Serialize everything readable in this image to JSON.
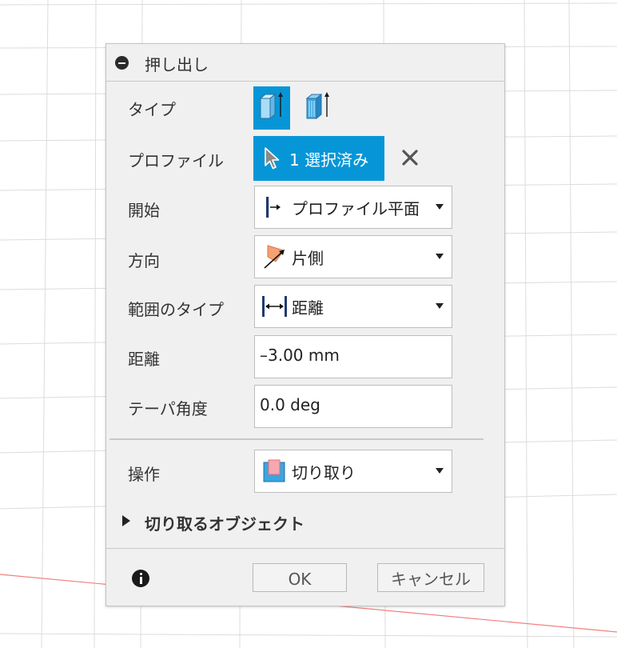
{
  "dialog": {
    "title": "押し出し",
    "rows": {
      "type": {
        "label": "タイプ"
      },
      "profile": {
        "label": "プロファイル",
        "value": "1 選択済み"
      },
      "start": {
        "label": "開始",
        "value": "プロファイル平面"
      },
      "direction": {
        "label": "方向",
        "value": "片側"
      },
      "extent_type": {
        "label": "範囲のタイプ",
        "value": "距離"
      },
      "distance": {
        "label": "距離",
        "value": "–3.00 mm"
      },
      "taper": {
        "label": "テーパ角度",
        "value": "0.0 deg"
      },
      "operation": {
        "label": "操作",
        "value": "切り取り"
      }
    },
    "objects_to_cut": {
      "label": "切り取るオブジェクト"
    },
    "footer": {
      "ok_label": "OK",
      "cancel_label": "キャンセル"
    }
  },
  "colors": {
    "accent": "#0696d7",
    "dialog_bg": "#f0f0f0",
    "grid": "#d8d8d8",
    "axis_red": "#f08080"
  },
  "icons": {
    "title": "collapse-minus-icon",
    "type_solid": "solid-extrude-icon",
    "type_thin": "thin-extrude-icon",
    "profile": "select-cursor-icon",
    "clear": "close-x-icon",
    "start": "profile-plane-start-icon",
    "direction": "one-side-direction-icon",
    "extent": "distance-extent-icon",
    "operation": "cut-operation-icon",
    "info": "info-icon"
  }
}
